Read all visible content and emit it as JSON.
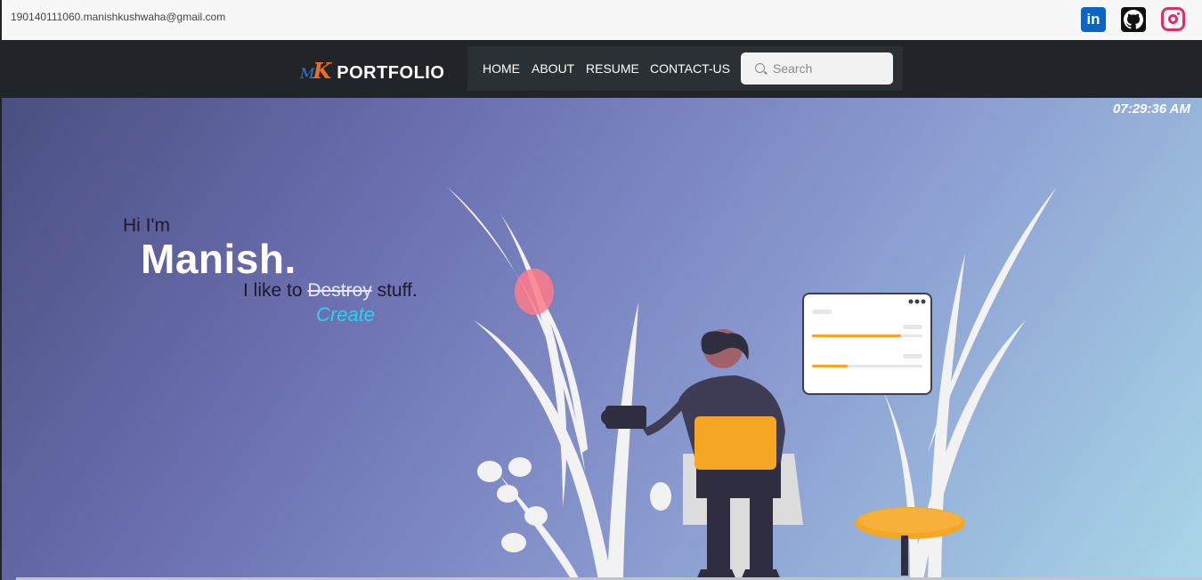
{
  "topbar": {
    "email": "190140111060.manishkushwaha@gmail.com",
    "social": [
      {
        "name": "linkedin-icon",
        "glyph": "in"
      },
      {
        "name": "github-icon"
      },
      {
        "name": "instagram-icon"
      }
    ]
  },
  "navbar": {
    "brand_m": "M",
    "brand_k": "K",
    "brand_text": "PORTFOLIO",
    "links": [
      "HOME",
      "ABOUT",
      "RESUME",
      "CONTACT-US"
    ],
    "search_placeholder": "Search"
  },
  "hero": {
    "clock": "07:29:36 AM",
    "greeting": "Hi I'm",
    "name": "Manish.",
    "tagline_prefix": "I like to",
    "tagline_struck": "Destroy",
    "tagline_suffix": "stuff.",
    "tagline_replacement": "Create"
  },
  "colors": {
    "navbar": "#212529",
    "accent_cyan": "#29d3f0",
    "laptop": "#f5a623",
    "brand_orange": "#f26b21",
    "brand_blue": "#2d7dd2"
  }
}
